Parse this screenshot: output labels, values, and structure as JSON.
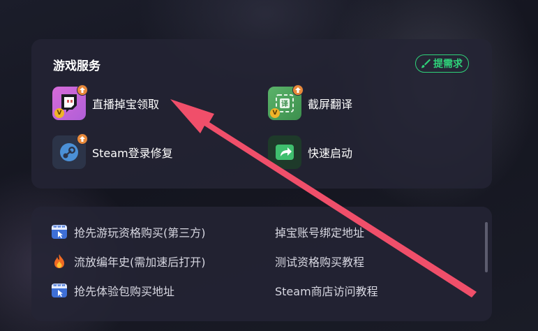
{
  "services": {
    "title": "游戏服务",
    "request_label": "提需求",
    "items": [
      {
        "label": "直播掉宝领取",
        "icon": "twitch-drops-icon"
      },
      {
        "label": "截屏翻译",
        "icon": "screenshot-translate-icon"
      },
      {
        "label": "Steam登录修复",
        "icon": "steam-icon"
      },
      {
        "label": "快速启动",
        "icon": "quick-launch-icon"
      }
    ]
  },
  "links": {
    "items": [
      {
        "label": "抢先游玩资格购买(第三方)",
        "icon": "www-icon"
      },
      {
        "label": "掉宝账号绑定地址",
        "icon": ""
      },
      {
        "label": "流放编年史(需加速后打开)",
        "icon": "fire-icon"
      },
      {
        "label": "测试资格购买教程",
        "icon": ""
      },
      {
        "label": "抢先体验包购买地址",
        "icon": "www-icon"
      },
      {
        "label": "Steam商店访问教程",
        "icon": ""
      }
    ]
  },
  "badge_text": "V",
  "colors": {
    "accent_green": "#2fd37a",
    "annotation_arrow": "#f04f6a",
    "panel_bg": "#242434"
  }
}
